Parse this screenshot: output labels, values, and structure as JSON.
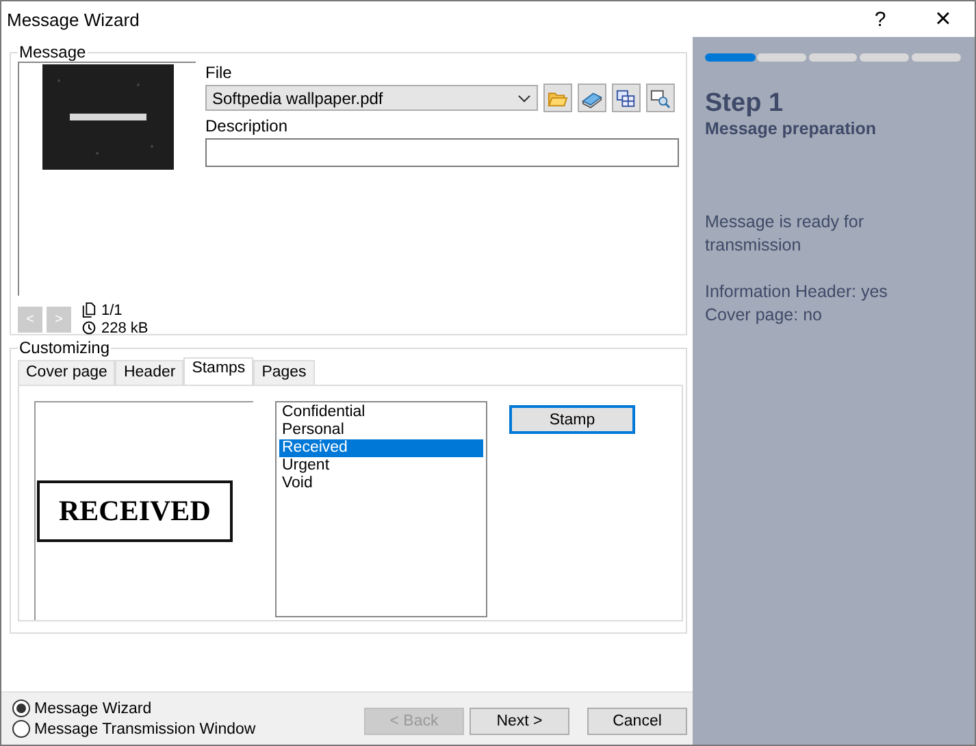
{
  "window": {
    "title": "Message Wizard",
    "help": "?",
    "close": "×"
  },
  "message": {
    "legend": "Message",
    "file_label": "File",
    "file": "Softpedia wallpaper.pdf",
    "description_label": "Description",
    "prev": "<",
    "next": ">",
    "disabled_nav": true,
    "pages": "1/1",
    "size": "228 kB"
  },
  "customizing": {
    "legend": "Customizing",
    "tabs": [
      {
        "label": "Cover page",
        "selected": false
      },
      {
        "label": "Header",
        "selected": false
      },
      {
        "label": "Stamps",
        "selected": true
      },
      {
        "label": "Pages",
        "selected": false
      }
    ],
    "stamp_preview": "RECEIVED",
    "stamps": [
      {
        "label": "Confidential",
        "selected": false
      },
      {
        "label": "Personal",
        "selected": false
      },
      {
        "label": "Received",
        "selected": true
      },
      {
        "label": "Urgent",
        "selected": false
      },
      {
        "label": "Void",
        "selected": false
      }
    ],
    "stamp_button": "Stamp"
  },
  "mode": [
    {
      "label": "Message Wizard",
      "selected": true
    },
    {
      "label": "Message Transmission Window",
      "selected": false
    }
  ],
  "buttons": [
    {
      "label": "< Back",
      "disabled": true
    },
    {
      "label": "Next >",
      "disabled": false
    },
    {
      "label": "Cancel",
      "disabled": false
    }
  ],
  "side": {
    "progress": {
      "level": 0.2
    },
    "step": "Step 1",
    "subtitle": "Message preparation",
    "status": "Message is ready for transmission",
    "info": [
      "Information Header: yes",
      "Cover page: no"
    ]
  }
}
